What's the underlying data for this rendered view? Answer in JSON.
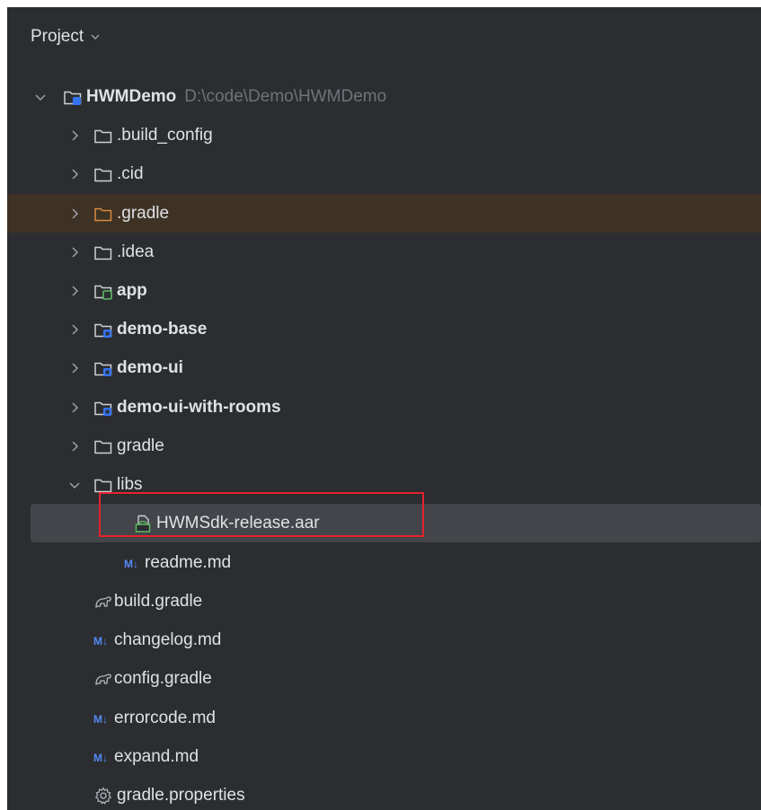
{
  "header": {
    "title": "Project"
  },
  "root": {
    "name": "HWMDemo",
    "path": "D:\\code\\Demo\\HWMDemo"
  },
  "items": [
    {
      "label": ".build_config"
    },
    {
      "label": ".cid"
    },
    {
      "label": ".gradle"
    },
    {
      "label": ".idea"
    },
    {
      "label": "app"
    },
    {
      "label": "demo-base"
    },
    {
      "label": "demo-ui"
    },
    {
      "label": "demo-ui-with-rooms"
    },
    {
      "label": "gradle"
    },
    {
      "label": "libs"
    },
    {
      "label": "HWMSdk-release.aar"
    },
    {
      "label": "readme.md"
    },
    {
      "label": "build.gradle"
    },
    {
      "label": "changelog.md"
    },
    {
      "label": "config.gradle"
    },
    {
      "label": "errorcode.md"
    },
    {
      "label": "expand.md"
    },
    {
      "label": "gradle.properties"
    }
  ],
  "colors": {
    "background": "#2b2d30",
    "text": "#dfe1e5",
    "muted_path": "#6f737a",
    "excluded_folder": "#d98c43",
    "excluded_row": "#3d3223",
    "selected_row": "#43454a",
    "highlight_box": "#e5232d",
    "module_badge": "#3574f0",
    "app_badge": "#5fb865",
    "markdown_badge": "#548af7"
  },
  "icons": {
    "collapsed_arrow": "chevron-right-icon",
    "expanded_arrow": "chevron-down-icon",
    "folder": "folder-icon",
    "module_folder": "module-folder-icon",
    "archive": "aar-archive-icon",
    "markdown": "markdown-icon",
    "gradle": "gradle-icon",
    "properties": "gear-icon"
  }
}
